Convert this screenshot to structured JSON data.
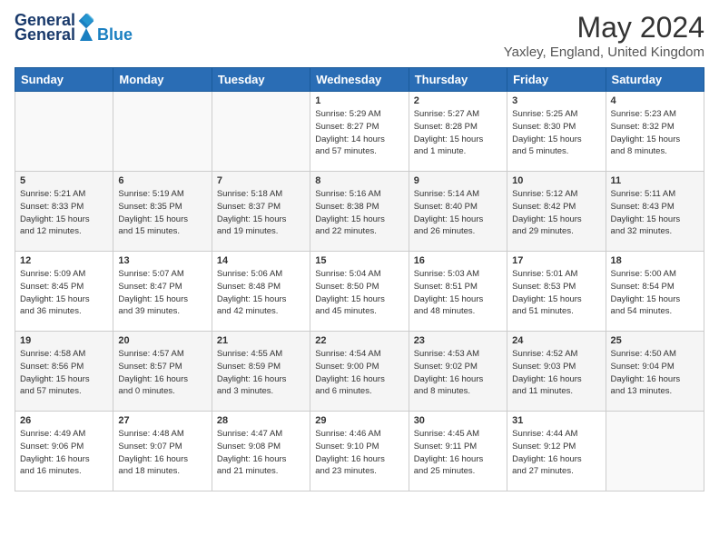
{
  "header": {
    "logo_general": "General",
    "logo_blue": "Blue",
    "month_title": "May 2024",
    "location": "Yaxley, England, United Kingdom"
  },
  "days_of_week": [
    "Sunday",
    "Monday",
    "Tuesday",
    "Wednesday",
    "Thursday",
    "Friday",
    "Saturday"
  ],
  "weeks": [
    [
      {
        "day": "",
        "info": ""
      },
      {
        "day": "",
        "info": ""
      },
      {
        "day": "",
        "info": ""
      },
      {
        "day": "1",
        "info": "Sunrise: 5:29 AM\nSunset: 8:27 PM\nDaylight: 14 hours\nand 57 minutes."
      },
      {
        "day": "2",
        "info": "Sunrise: 5:27 AM\nSunset: 8:28 PM\nDaylight: 15 hours\nand 1 minute."
      },
      {
        "day": "3",
        "info": "Sunrise: 5:25 AM\nSunset: 8:30 PM\nDaylight: 15 hours\nand 5 minutes."
      },
      {
        "day": "4",
        "info": "Sunrise: 5:23 AM\nSunset: 8:32 PM\nDaylight: 15 hours\nand 8 minutes."
      }
    ],
    [
      {
        "day": "5",
        "info": "Sunrise: 5:21 AM\nSunset: 8:33 PM\nDaylight: 15 hours\nand 12 minutes."
      },
      {
        "day": "6",
        "info": "Sunrise: 5:19 AM\nSunset: 8:35 PM\nDaylight: 15 hours\nand 15 minutes."
      },
      {
        "day": "7",
        "info": "Sunrise: 5:18 AM\nSunset: 8:37 PM\nDaylight: 15 hours\nand 19 minutes."
      },
      {
        "day": "8",
        "info": "Sunrise: 5:16 AM\nSunset: 8:38 PM\nDaylight: 15 hours\nand 22 minutes."
      },
      {
        "day": "9",
        "info": "Sunrise: 5:14 AM\nSunset: 8:40 PM\nDaylight: 15 hours\nand 26 minutes."
      },
      {
        "day": "10",
        "info": "Sunrise: 5:12 AM\nSunset: 8:42 PM\nDaylight: 15 hours\nand 29 minutes."
      },
      {
        "day": "11",
        "info": "Sunrise: 5:11 AM\nSunset: 8:43 PM\nDaylight: 15 hours\nand 32 minutes."
      }
    ],
    [
      {
        "day": "12",
        "info": "Sunrise: 5:09 AM\nSunset: 8:45 PM\nDaylight: 15 hours\nand 36 minutes."
      },
      {
        "day": "13",
        "info": "Sunrise: 5:07 AM\nSunset: 8:47 PM\nDaylight: 15 hours\nand 39 minutes."
      },
      {
        "day": "14",
        "info": "Sunrise: 5:06 AM\nSunset: 8:48 PM\nDaylight: 15 hours\nand 42 minutes."
      },
      {
        "day": "15",
        "info": "Sunrise: 5:04 AM\nSunset: 8:50 PM\nDaylight: 15 hours\nand 45 minutes."
      },
      {
        "day": "16",
        "info": "Sunrise: 5:03 AM\nSunset: 8:51 PM\nDaylight: 15 hours\nand 48 minutes."
      },
      {
        "day": "17",
        "info": "Sunrise: 5:01 AM\nSunset: 8:53 PM\nDaylight: 15 hours\nand 51 minutes."
      },
      {
        "day": "18",
        "info": "Sunrise: 5:00 AM\nSunset: 8:54 PM\nDaylight: 15 hours\nand 54 minutes."
      }
    ],
    [
      {
        "day": "19",
        "info": "Sunrise: 4:58 AM\nSunset: 8:56 PM\nDaylight: 15 hours\nand 57 minutes."
      },
      {
        "day": "20",
        "info": "Sunrise: 4:57 AM\nSunset: 8:57 PM\nDaylight: 16 hours\nand 0 minutes."
      },
      {
        "day": "21",
        "info": "Sunrise: 4:55 AM\nSunset: 8:59 PM\nDaylight: 16 hours\nand 3 minutes."
      },
      {
        "day": "22",
        "info": "Sunrise: 4:54 AM\nSunset: 9:00 PM\nDaylight: 16 hours\nand 6 minutes."
      },
      {
        "day": "23",
        "info": "Sunrise: 4:53 AM\nSunset: 9:02 PM\nDaylight: 16 hours\nand 8 minutes."
      },
      {
        "day": "24",
        "info": "Sunrise: 4:52 AM\nSunset: 9:03 PM\nDaylight: 16 hours\nand 11 minutes."
      },
      {
        "day": "25",
        "info": "Sunrise: 4:50 AM\nSunset: 9:04 PM\nDaylight: 16 hours\nand 13 minutes."
      }
    ],
    [
      {
        "day": "26",
        "info": "Sunrise: 4:49 AM\nSunset: 9:06 PM\nDaylight: 16 hours\nand 16 minutes."
      },
      {
        "day": "27",
        "info": "Sunrise: 4:48 AM\nSunset: 9:07 PM\nDaylight: 16 hours\nand 18 minutes."
      },
      {
        "day": "28",
        "info": "Sunrise: 4:47 AM\nSunset: 9:08 PM\nDaylight: 16 hours\nand 21 minutes."
      },
      {
        "day": "29",
        "info": "Sunrise: 4:46 AM\nSunset: 9:10 PM\nDaylight: 16 hours\nand 23 minutes."
      },
      {
        "day": "30",
        "info": "Sunrise: 4:45 AM\nSunset: 9:11 PM\nDaylight: 16 hours\nand 25 minutes."
      },
      {
        "day": "31",
        "info": "Sunrise: 4:44 AM\nSunset: 9:12 PM\nDaylight: 16 hours\nand 27 minutes."
      },
      {
        "day": "",
        "info": ""
      }
    ]
  ]
}
